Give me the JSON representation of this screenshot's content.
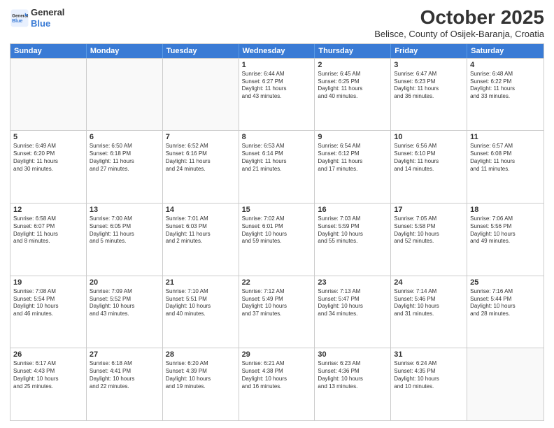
{
  "header": {
    "logo_general": "General",
    "logo_blue": "Blue",
    "month": "October 2025",
    "location": "Belisce, County of Osijek-Baranja, Croatia"
  },
  "weekdays": [
    "Sunday",
    "Monday",
    "Tuesday",
    "Wednesday",
    "Thursday",
    "Friday",
    "Saturday"
  ],
  "rows": [
    [
      {
        "day": "",
        "info": ""
      },
      {
        "day": "",
        "info": ""
      },
      {
        "day": "",
        "info": ""
      },
      {
        "day": "1",
        "info": "Sunrise: 6:44 AM\nSunset: 6:27 PM\nDaylight: 11 hours\nand 43 minutes."
      },
      {
        "day": "2",
        "info": "Sunrise: 6:45 AM\nSunset: 6:25 PM\nDaylight: 11 hours\nand 40 minutes."
      },
      {
        "day": "3",
        "info": "Sunrise: 6:47 AM\nSunset: 6:23 PM\nDaylight: 11 hours\nand 36 minutes."
      },
      {
        "day": "4",
        "info": "Sunrise: 6:48 AM\nSunset: 6:22 PM\nDaylight: 11 hours\nand 33 minutes."
      }
    ],
    [
      {
        "day": "5",
        "info": "Sunrise: 6:49 AM\nSunset: 6:20 PM\nDaylight: 11 hours\nand 30 minutes."
      },
      {
        "day": "6",
        "info": "Sunrise: 6:50 AM\nSunset: 6:18 PM\nDaylight: 11 hours\nand 27 minutes."
      },
      {
        "day": "7",
        "info": "Sunrise: 6:52 AM\nSunset: 6:16 PM\nDaylight: 11 hours\nand 24 minutes."
      },
      {
        "day": "8",
        "info": "Sunrise: 6:53 AM\nSunset: 6:14 PM\nDaylight: 11 hours\nand 21 minutes."
      },
      {
        "day": "9",
        "info": "Sunrise: 6:54 AM\nSunset: 6:12 PM\nDaylight: 11 hours\nand 17 minutes."
      },
      {
        "day": "10",
        "info": "Sunrise: 6:56 AM\nSunset: 6:10 PM\nDaylight: 11 hours\nand 14 minutes."
      },
      {
        "day": "11",
        "info": "Sunrise: 6:57 AM\nSunset: 6:08 PM\nDaylight: 11 hours\nand 11 minutes."
      }
    ],
    [
      {
        "day": "12",
        "info": "Sunrise: 6:58 AM\nSunset: 6:07 PM\nDaylight: 11 hours\nand 8 minutes."
      },
      {
        "day": "13",
        "info": "Sunrise: 7:00 AM\nSunset: 6:05 PM\nDaylight: 11 hours\nand 5 minutes."
      },
      {
        "day": "14",
        "info": "Sunrise: 7:01 AM\nSunset: 6:03 PM\nDaylight: 11 hours\nand 2 minutes."
      },
      {
        "day": "15",
        "info": "Sunrise: 7:02 AM\nSunset: 6:01 PM\nDaylight: 10 hours\nand 59 minutes."
      },
      {
        "day": "16",
        "info": "Sunrise: 7:03 AM\nSunset: 5:59 PM\nDaylight: 10 hours\nand 55 minutes."
      },
      {
        "day": "17",
        "info": "Sunrise: 7:05 AM\nSunset: 5:58 PM\nDaylight: 10 hours\nand 52 minutes."
      },
      {
        "day": "18",
        "info": "Sunrise: 7:06 AM\nSunset: 5:56 PM\nDaylight: 10 hours\nand 49 minutes."
      }
    ],
    [
      {
        "day": "19",
        "info": "Sunrise: 7:08 AM\nSunset: 5:54 PM\nDaylight: 10 hours\nand 46 minutes."
      },
      {
        "day": "20",
        "info": "Sunrise: 7:09 AM\nSunset: 5:52 PM\nDaylight: 10 hours\nand 43 minutes."
      },
      {
        "day": "21",
        "info": "Sunrise: 7:10 AM\nSunset: 5:51 PM\nDaylight: 10 hours\nand 40 minutes."
      },
      {
        "day": "22",
        "info": "Sunrise: 7:12 AM\nSunset: 5:49 PM\nDaylight: 10 hours\nand 37 minutes."
      },
      {
        "day": "23",
        "info": "Sunrise: 7:13 AM\nSunset: 5:47 PM\nDaylight: 10 hours\nand 34 minutes."
      },
      {
        "day": "24",
        "info": "Sunrise: 7:14 AM\nSunset: 5:46 PM\nDaylight: 10 hours\nand 31 minutes."
      },
      {
        "day": "25",
        "info": "Sunrise: 7:16 AM\nSunset: 5:44 PM\nDaylight: 10 hours\nand 28 minutes."
      }
    ],
    [
      {
        "day": "26",
        "info": "Sunrise: 6:17 AM\nSunset: 4:43 PM\nDaylight: 10 hours\nand 25 minutes."
      },
      {
        "day": "27",
        "info": "Sunrise: 6:18 AM\nSunset: 4:41 PM\nDaylight: 10 hours\nand 22 minutes."
      },
      {
        "day": "28",
        "info": "Sunrise: 6:20 AM\nSunset: 4:39 PM\nDaylight: 10 hours\nand 19 minutes."
      },
      {
        "day": "29",
        "info": "Sunrise: 6:21 AM\nSunset: 4:38 PM\nDaylight: 10 hours\nand 16 minutes."
      },
      {
        "day": "30",
        "info": "Sunrise: 6:23 AM\nSunset: 4:36 PM\nDaylight: 10 hours\nand 13 minutes."
      },
      {
        "day": "31",
        "info": "Sunrise: 6:24 AM\nSunset: 4:35 PM\nDaylight: 10 hours\nand 10 minutes."
      },
      {
        "day": "",
        "info": ""
      }
    ]
  ]
}
